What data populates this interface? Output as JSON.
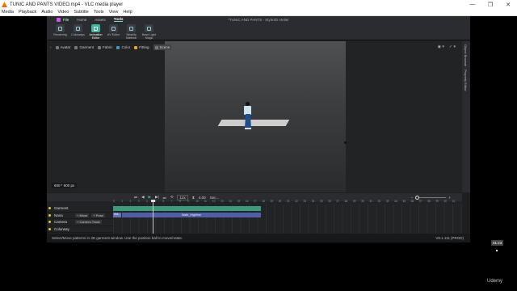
{
  "vlc": {
    "title": "TUNIC AND PANTS VIDEO.mp4 - VLC media player",
    "menu": [
      "Media",
      "Playback",
      "Audio",
      "Video",
      "Subtitle",
      "Tools",
      "View",
      "Help"
    ],
    "window_buttons": [
      "—",
      "❐",
      "✕"
    ]
  },
  "app": {
    "file_label": "File",
    "tabs": [
      "Home",
      "Assets",
      "Tools"
    ],
    "active_tab": "Tools",
    "document_title": "*TUNIC AND PANTS - Style3D Atelier",
    "tools": [
      {
        "label": "Rendering",
        "icon": "rendering-icon"
      },
      {
        "label": "Colorways",
        "icon": "colorways-icon"
      },
      {
        "label": "Animation Editor",
        "icon": "animation-editor-icon",
        "active": true
      },
      {
        "label": "UV Editor",
        "icon": "uv-editor-icon"
      },
      {
        "label": "Simplify Material",
        "icon": "simplify-material-icon"
      },
      {
        "label": "Base Light Magic",
        "icon": "base-light-magic-icon"
      }
    ],
    "viewport": {
      "tools": [
        "Avatar",
        "Garment",
        "Fabric",
        "Color",
        "Fitting",
        "Scene"
      ],
      "size_badge": "600 * 600 px",
      "right_icons": [
        "◉ ▾",
        "✓ ▾"
      ]
    },
    "side_panel": [
      "Object Browser",
      "Property Editor"
    ],
    "timeline": {
      "fps": "12x",
      "time": "4.00",
      "mode": "Sec...",
      "tracks": [
        {
          "name": "Garment",
          "chips": []
        },
        {
          "name": "Nana",
          "chips": [
            "+ Move",
            "+ Pose"
          ]
        },
        {
          "name": "Camera",
          "chips": [
            "+ Camera Track"
          ]
        },
        {
          "name": "Colorway",
          "chips": []
        }
      ],
      "ruler": [
        "0",
        "1",
        "2",
        "3",
        "4",
        "5",
        "6",
        "7",
        "8",
        "9",
        "10",
        "11",
        "12",
        "13",
        "14",
        "15",
        "16",
        "17",
        "18",
        "19",
        "20",
        "21",
        "22",
        "23",
        "24",
        "25",
        "26",
        "27",
        "28",
        "29",
        "30",
        "31",
        "32",
        "33",
        "34",
        "35",
        "36",
        "37",
        "38",
        "39",
        "40",
        "41"
      ],
      "clip_start_label": "Wal...",
      "clip_label": "Walk_Highline"
    },
    "status_text": "Select/Move patterns in 3D garment window. Use the position ball to move/rotate.",
    "version": "V8.1.111 (PROD)"
  },
  "overlay": {
    "time_bubble": "01:23",
    "watermark": "Udemy"
  }
}
